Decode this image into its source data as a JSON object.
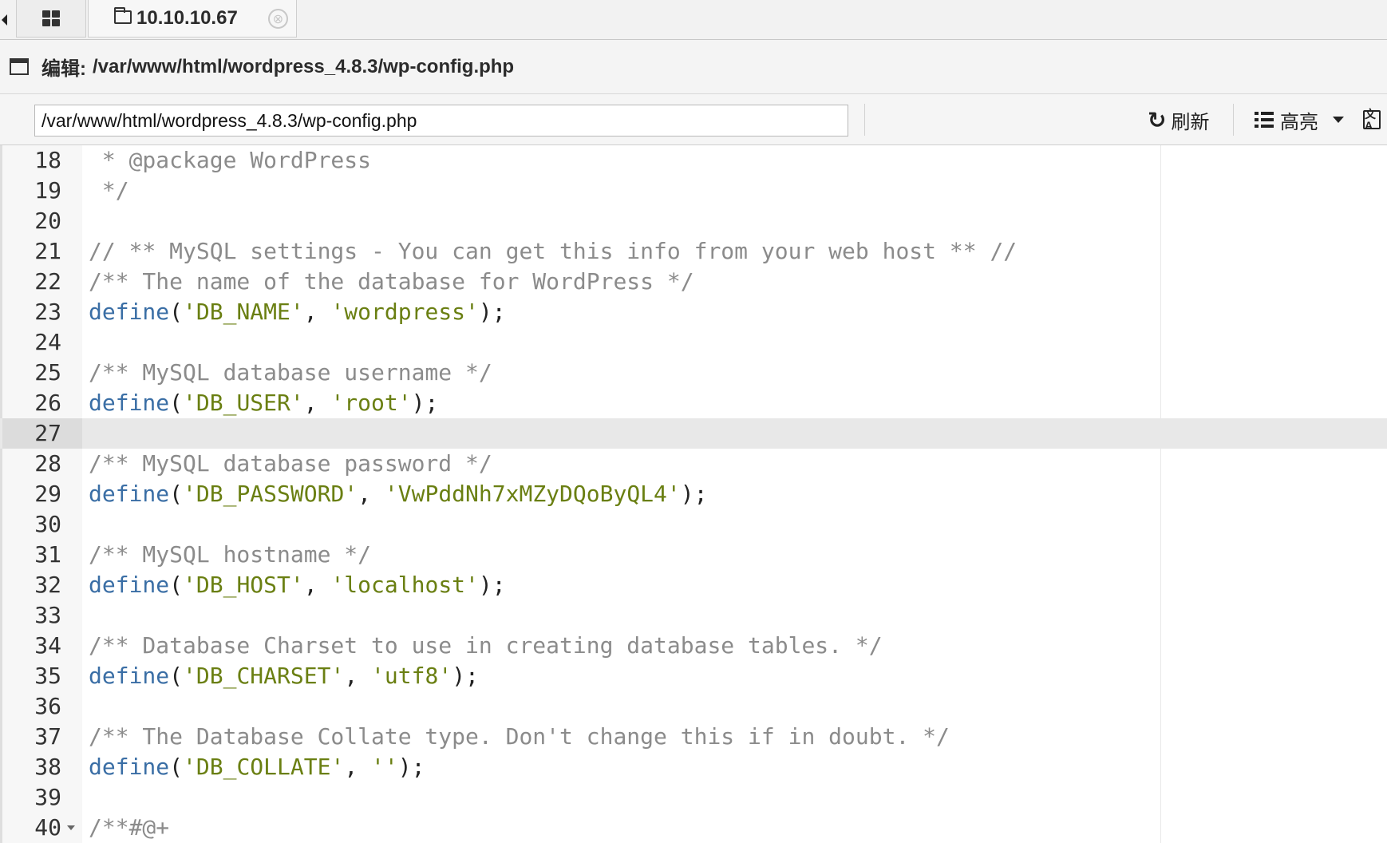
{
  "tabs": {
    "grid_icon": "grid-icon",
    "host_label": "10.10.10.67",
    "close_glyph": "⊗"
  },
  "title": {
    "prefix": "编辑:",
    "path": "/var/www/html/wordpress_4.8.3/wp-config.php"
  },
  "toolbar": {
    "path_value": "/var/www/html/wordpress_4.8.3/wp-config.php",
    "refresh_label": "刷新",
    "highlight_label": "高亮",
    "translate_glyph": "文A"
  },
  "editor": {
    "active_line": 27,
    "lines": [
      {
        "no": "18",
        "fold": false,
        "tokens": [
          {
            "t": " * @package WordPress",
            "k": "comment"
          }
        ]
      },
      {
        "no": "19",
        "fold": false,
        "tokens": [
          {
            "t": " */",
            "k": "comment"
          }
        ]
      },
      {
        "no": "20",
        "fold": false,
        "tokens": []
      },
      {
        "no": "21",
        "fold": false,
        "tokens": [
          {
            "t": "// ** MySQL settings - You can get this info from your web host ** //",
            "k": "comment"
          }
        ]
      },
      {
        "no": "22",
        "fold": false,
        "tokens": [
          {
            "t": "/** The name of the database for WordPress */",
            "k": "comment"
          }
        ]
      },
      {
        "no": "23",
        "fold": false,
        "tokens": [
          {
            "t": "define",
            "k": "fn"
          },
          {
            "t": "(",
            "k": "punc"
          },
          {
            "t": "'DB_NAME'",
            "k": "str"
          },
          {
            "t": ", ",
            "k": "punc"
          },
          {
            "t": "'wordpress'",
            "k": "str"
          },
          {
            "t": ");",
            "k": "punc"
          }
        ]
      },
      {
        "no": "24",
        "fold": false,
        "tokens": []
      },
      {
        "no": "25",
        "fold": false,
        "tokens": [
          {
            "t": "/** MySQL database username */",
            "k": "comment"
          }
        ]
      },
      {
        "no": "26",
        "fold": false,
        "tokens": [
          {
            "t": "define",
            "k": "fn"
          },
          {
            "t": "(",
            "k": "punc"
          },
          {
            "t": "'DB_USER'",
            "k": "str"
          },
          {
            "t": ", ",
            "k": "punc"
          },
          {
            "t": "'root'",
            "k": "str"
          },
          {
            "t": ");",
            "k": "punc"
          }
        ]
      },
      {
        "no": "27",
        "fold": false,
        "tokens": []
      },
      {
        "no": "28",
        "fold": false,
        "tokens": [
          {
            "t": "/** MySQL database password */",
            "k": "comment"
          }
        ]
      },
      {
        "no": "29",
        "fold": false,
        "tokens": [
          {
            "t": "define",
            "k": "fn"
          },
          {
            "t": "(",
            "k": "punc"
          },
          {
            "t": "'DB_PASSWORD'",
            "k": "str"
          },
          {
            "t": ", ",
            "k": "punc"
          },
          {
            "t": "'VwPddNh7xMZyDQoByQL4'",
            "k": "str"
          },
          {
            "t": ");",
            "k": "punc"
          }
        ]
      },
      {
        "no": "30",
        "fold": false,
        "tokens": []
      },
      {
        "no": "31",
        "fold": false,
        "tokens": [
          {
            "t": "/** MySQL hostname */",
            "k": "comment"
          }
        ]
      },
      {
        "no": "32",
        "fold": false,
        "tokens": [
          {
            "t": "define",
            "k": "fn"
          },
          {
            "t": "(",
            "k": "punc"
          },
          {
            "t": "'DB_HOST'",
            "k": "str"
          },
          {
            "t": ", ",
            "k": "punc"
          },
          {
            "t": "'localhost'",
            "k": "str"
          },
          {
            "t": ");",
            "k": "punc"
          }
        ]
      },
      {
        "no": "33",
        "fold": false,
        "tokens": []
      },
      {
        "no": "34",
        "fold": false,
        "tokens": [
          {
            "t": "/** Database Charset to use in creating database tables. */",
            "k": "comment"
          }
        ]
      },
      {
        "no": "35",
        "fold": false,
        "tokens": [
          {
            "t": "define",
            "k": "fn"
          },
          {
            "t": "(",
            "k": "punc"
          },
          {
            "t": "'DB_CHARSET'",
            "k": "str"
          },
          {
            "t": ", ",
            "k": "punc"
          },
          {
            "t": "'utf8'",
            "k": "str"
          },
          {
            "t": ");",
            "k": "punc"
          }
        ]
      },
      {
        "no": "36",
        "fold": false,
        "tokens": []
      },
      {
        "no": "37",
        "fold": false,
        "tokens": [
          {
            "t": "/** The Database Collate type. Don't change this if in doubt. */",
            "k": "comment"
          }
        ]
      },
      {
        "no": "38",
        "fold": false,
        "tokens": [
          {
            "t": "define",
            "k": "fn"
          },
          {
            "t": "(",
            "k": "punc"
          },
          {
            "t": "'DB_COLLATE'",
            "k": "str"
          },
          {
            "t": ", ",
            "k": "punc"
          },
          {
            "t": "''",
            "k": "str"
          },
          {
            "t": ");",
            "k": "punc"
          }
        ]
      },
      {
        "no": "39",
        "fold": false,
        "tokens": []
      },
      {
        "no": "40",
        "fold": true,
        "tokens": [
          {
            "t": "/**#@+",
            "k": "comment"
          }
        ]
      }
    ]
  },
  "colors": {
    "comment": "#8b8b8b",
    "function": "#3a6ea5",
    "string": "#6a7f12",
    "active_line": "#e8e8e8"
  }
}
